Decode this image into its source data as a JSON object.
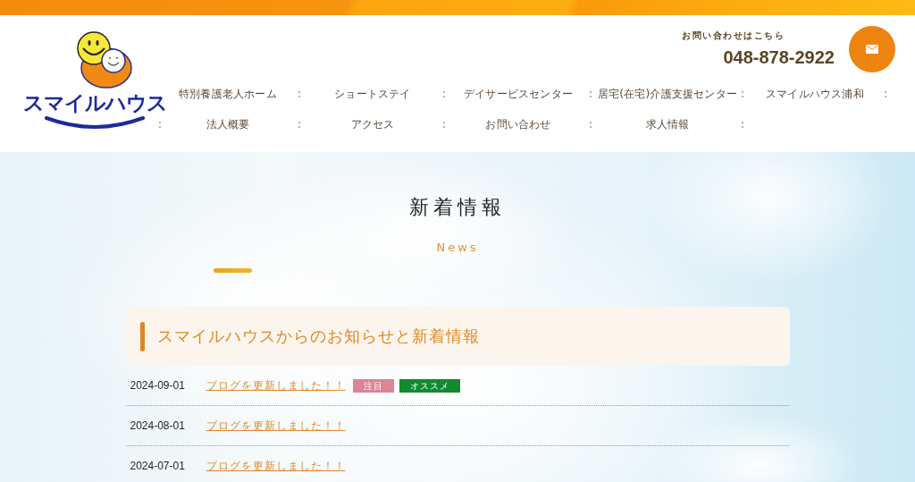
{
  "header": {
    "logo": {
      "text": "スマイルハウス"
    },
    "contact": {
      "label": "お問い合わせはこちら",
      "phone": "048-878-2922"
    }
  },
  "nav": {
    "items": [
      "特別養護老人ホーム",
      "ショートステイ",
      "デイサービスセンター",
      "居宅(在宅)介護支援センター",
      "スマイルハウス浦和",
      "法人概要",
      "アクセス",
      "お問い合わせ",
      "求人情報"
    ]
  },
  "news_section": {
    "title": "新着情報",
    "subtitle": "News",
    "heading": "スマイルハウスからのお知らせと新着情報",
    "items": [
      {
        "date": "2024-09-01",
        "title": "ブログを更新しました！！",
        "tags": [
          {
            "label": "注目",
            "color": "#dc8594"
          },
          {
            "label": "オススメ",
            "color": "#128a2e"
          }
        ]
      },
      {
        "date": "2024-08-01",
        "title": "ブログを更新しました！！"
      },
      {
        "date": "2024-07-01",
        "title": "ブログを更新しました！！"
      }
    ]
  }
}
